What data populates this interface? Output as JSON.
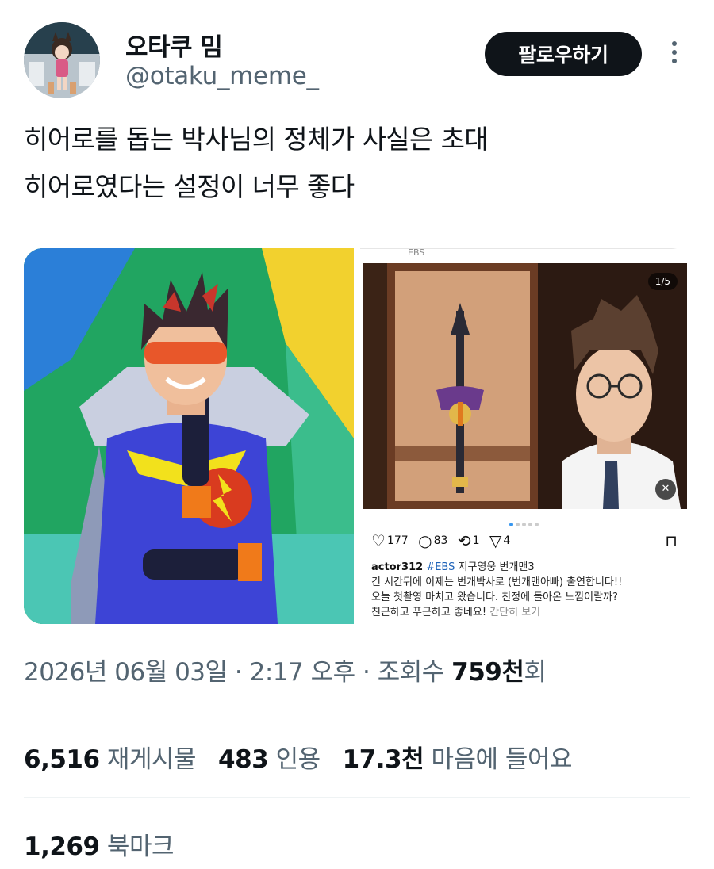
{
  "author": {
    "display_name": "오타쿠 밈",
    "handle": "@otaku_meme_",
    "avatar_icon": "anime-character-avatar"
  },
  "actions": {
    "follow_label": "팔로우하기",
    "more_icon": "vertical-ellipsis-icon"
  },
  "tweet": {
    "text_lines": [
      "히어로를 돕는 박사님의 정체가 사실은 초대",
      "히어로였다는 설정이 너무 좋다"
    ]
  },
  "media": {
    "instagram_post": {
      "source_label": "EBS",
      "counter": "1/5",
      "likes": "177",
      "comments": "83",
      "reposts": "1",
      "shares": "4",
      "caption": {
        "username": "actor312",
        "hashtag": "#EBS",
        "title": "지구영웅 번개맨3",
        "lines": [
          "긴 시간뒤에 이제는 번개박사로 (번개맨아빠) 출연합니다!!",
          "오늘 첫촬영 마치고 왔습니다. 친정에 돌아온 느낌이랄까?"
        ],
        "last_line": "친근하고 푸근하고 좋네요!",
        "more": "간단히 보기"
      }
    }
  },
  "meta": {
    "date": "2026년 06월 03일",
    "separator": " · ",
    "time": "2:17 오후",
    "views_prefix": "조회수 ",
    "views_count": "759천",
    "views_suffix": "회"
  },
  "stats": {
    "reposts_count": "6,516",
    "reposts_label": "재게시물",
    "quotes_count": "483",
    "quotes_label": "인용",
    "likes_count": "17.3천",
    "likes_label": "마음에 들어요",
    "bookmarks_count": "1,269",
    "bookmarks_label": "북마크"
  },
  "colors": {
    "text_primary": "#0f1419",
    "text_secondary": "#536471",
    "button_bg": "#0f1419",
    "divider": "#eff3f4"
  }
}
